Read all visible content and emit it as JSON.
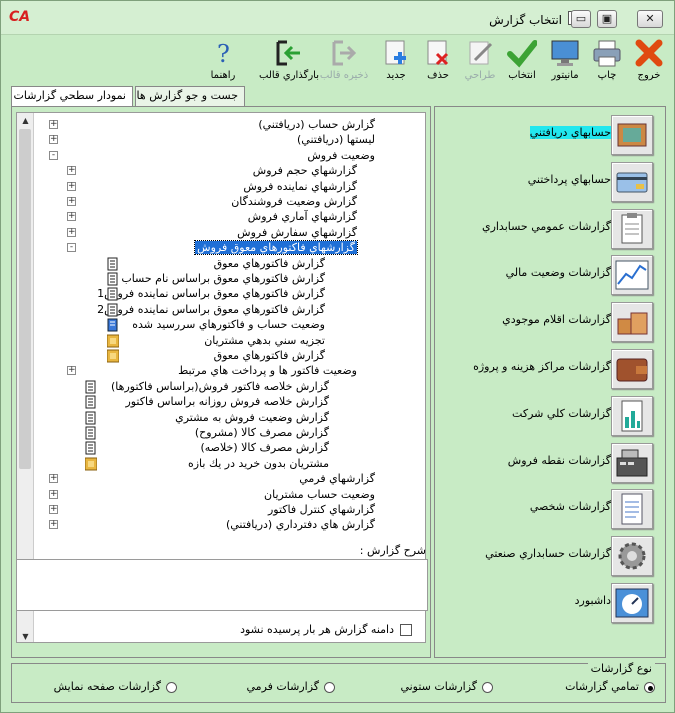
{
  "window": {
    "title": "انتخاب گزارش",
    "logo": "CA",
    "minimize": "▭",
    "restore": "▣",
    "close": "✕"
  },
  "toolbar": [
    {
      "name": "exit-button",
      "label": "خروج",
      "icon": "close-x-icon",
      "enabled": true
    },
    {
      "name": "print-button",
      "label": "چاپ",
      "icon": "printer-icon",
      "enabled": true
    },
    {
      "name": "monitor-button",
      "label": "مانيتور",
      "icon": "monitor-icon",
      "enabled": true
    },
    {
      "name": "select-button",
      "label": "انتخاب",
      "icon": "checkmark-icon",
      "enabled": true
    },
    {
      "name": "design-button",
      "label": "طراحي",
      "icon": "pen-icon",
      "enabled": false
    },
    {
      "name": "delete-button",
      "label": "حذف",
      "icon": "delete-doc-icon",
      "enabled": true
    },
    {
      "name": "new-button",
      "label": "جديد",
      "icon": "new-doc-icon",
      "enabled": true
    },
    {
      "name": "save-template-button",
      "label": "ذخيره قالب",
      "icon": "export-icon",
      "enabled": false
    },
    {
      "name": "load-template-button",
      "label": "بارگذاري قالب",
      "icon": "import-icon",
      "enabled": true
    },
    {
      "name": "help-button",
      "label": "راهنما",
      "icon": "help-question-icon",
      "enabled": true
    }
  ],
  "tabs": [
    {
      "label": "نمودار سطحي گزارشات",
      "active": true
    },
    {
      "label": "جست و جو گزارش ها",
      "active": false
    }
  ],
  "tree": [
    {
      "label": "گزارش حساب (دريافتني)",
      "level": 0,
      "expander": "+",
      "icon": null
    },
    {
      "label": "ليستها (دريافتني)",
      "level": 0,
      "expander": "+",
      "icon": null
    },
    {
      "label": "وضعيت فروش",
      "level": 0,
      "expander": "-",
      "icon": null
    },
    {
      "label": "گزارشهاي حجم فروش",
      "level": 1,
      "expander": "+",
      "icon": null
    },
    {
      "label": "گزارشهاي نماينده فروش",
      "level": 1,
      "expander": "+",
      "icon": null
    },
    {
      "label": "گزارش وضعيت فروشندگان",
      "level": 1,
      "expander": "+",
      "icon": null
    },
    {
      "label": "گزارشهاي آماري فروش",
      "level": 1,
      "expander": "+",
      "icon": null
    },
    {
      "label": "گزارشهاي سفارش فروش",
      "level": 1,
      "expander": "+",
      "icon": null
    },
    {
      "label": "گزارشهاي فاكتورهاي معوق فروش",
      "level": 1,
      "expander": "-",
      "icon": null,
      "selected": true
    },
    {
      "label": "گزارش فاكتورهاي معوق",
      "level": 2,
      "expander": null,
      "icon": "report"
    },
    {
      "label": "گزارش فاكتورهاي معوق براساس نام حساب",
      "level": 2,
      "expander": null,
      "icon": "report"
    },
    {
      "label": "گزارش فاكتورهاي معوق براساس نماينده فروش1",
      "level": 2,
      "expander": null,
      "icon": "report"
    },
    {
      "label": "گزارش فاكتورهاي معوق براساس نماينده فروش2",
      "level": 2,
      "expander": null,
      "icon": "report"
    },
    {
      "label": "وضعيت حساب و فاكتورهاي سررسيد شده",
      "level": 2,
      "expander": null,
      "icon": "report-blue"
    },
    {
      "label": "تجزيه سني بدهي مشتريان",
      "level": 2,
      "expander": null,
      "icon": "folder"
    },
    {
      "label": "گزارش فاكتورهاي معوق",
      "level": 2,
      "expander": null,
      "icon": "folder"
    },
    {
      "label": "وضعيت فاكتور ها و پرداخت هاي مرتبط",
      "level": 1,
      "expander": "+",
      "icon": null
    },
    {
      "label": "گزارش خلاصه فاكتور فروش(براساس فاكتورها)",
      "level": 1,
      "expander": null,
      "icon": "report"
    },
    {
      "label": "گزارش خلاصه فروش روزانه براساس فاكتور",
      "level": 1,
      "expander": null,
      "icon": "report"
    },
    {
      "label": "گزارش وضعيت فروش به مشتري",
      "level": 1,
      "expander": null,
      "icon": "report"
    },
    {
      "label": "گزارش مصرف كالا (مشروح)",
      "level": 1,
      "expander": null,
      "icon": "report"
    },
    {
      "label": "گزارش مصرف كالا (خلاصه)",
      "level": 1,
      "expander": null,
      "icon": "report"
    },
    {
      "label": "مشتريان بدون خريد در يك بازه",
      "level": 1,
      "expander": null,
      "icon": "folder"
    },
    {
      "label": "گزارشهاي فرمي",
      "level": 0,
      "expander": "+",
      "icon": null
    },
    {
      "label": "وضعيت حساب مشتريان",
      "level": 0,
      "expander": "+",
      "icon": null
    },
    {
      "label": "گزارشهاي كنترل فاكتور",
      "level": 0,
      "expander": "+",
      "icon": null
    },
    {
      "label": "گزارش هاي دفترداري (دريافتني)",
      "level": 0,
      "expander": "+",
      "icon": null
    }
  ],
  "description": {
    "title": "شرح گزارش :",
    "value": ""
  },
  "checkbox": {
    "label": "دامنه گزارش هر بار پرسيده نشود",
    "checked": false
  },
  "categories": [
    {
      "label": "حسابهاي دريافتني",
      "icon": "cash-register-icon",
      "highlight": true
    },
    {
      "label": "حسابهاي پرداختني",
      "icon": "credit-card-icon",
      "highlight": false
    },
    {
      "label": "گزارشات عمومي حسابداري",
      "icon": "clipboard-icon",
      "highlight": false
    },
    {
      "label": "گزارشات وضعيت مالي",
      "icon": "line-chart-icon",
      "highlight": false
    },
    {
      "label": "گزارشات اقلام موجودي",
      "icon": "boxes-icon",
      "highlight": false
    },
    {
      "label": "گزارشات مراكز هزينه و پروژه",
      "icon": "wallet-icon",
      "highlight": false
    },
    {
      "label": "گزارشات كلي شركت",
      "icon": "bar-chart-icon",
      "highlight": false
    },
    {
      "label": "گزارشات نقطه فروش",
      "icon": "pos-terminal-icon",
      "highlight": false
    },
    {
      "label": "گزارشات شخصي",
      "icon": "document-icon",
      "highlight": false
    },
    {
      "label": "گزارشات حسابداري صنعتي",
      "icon": "gear-icon",
      "highlight": false
    },
    {
      "label": "داشبورد",
      "icon": "dashboard-icon",
      "highlight": false
    }
  ],
  "report_type": {
    "title": "نوع گزارشات",
    "options": [
      {
        "label": "تمامي گزارشات",
        "checked": true
      },
      {
        "label": "گزارشات ستوني",
        "checked": false
      },
      {
        "label": "گزارشات فرمي",
        "checked": false
      },
      {
        "label": "گزارشات صفحه نمايش",
        "checked": false
      }
    ]
  }
}
